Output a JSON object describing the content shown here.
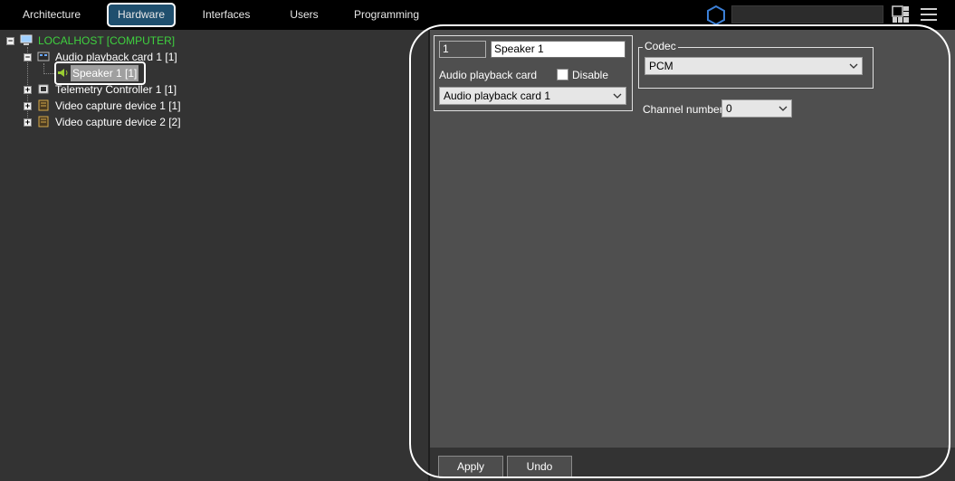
{
  "nav": {
    "tabs": [
      {
        "label": "Architecture"
      },
      {
        "label": "Hardware"
      },
      {
        "label": "Interfaces"
      },
      {
        "label": "Users"
      },
      {
        "label": "Programming"
      }
    ],
    "active_tab": "Hardware",
    "search": {
      "value": "",
      "placeholder": ""
    }
  },
  "tree": {
    "root": "LOCALHOST [COMPUTER]",
    "items": [
      {
        "label": "Audio playback card 1 [1]",
        "icon": "audio-card-icon",
        "expanded": true
      },
      {
        "label": "Speaker 1 [1]",
        "icon": "speaker-icon",
        "selected": true
      },
      {
        "label": "Telemetry Controller 1 [1]",
        "icon": "telemetry-icon",
        "expanded": false
      },
      {
        "label": "Video capture device 1 [1]",
        "icon": "video-card-icon",
        "expanded": false
      },
      {
        "label": "Video capture device 2 [2]",
        "icon": "video-card-icon",
        "expanded": false
      }
    ]
  },
  "settings": {
    "id_value": "1",
    "name_value": "Speaker 1",
    "audio_card_label": "Audio playback card",
    "disable_label": "Disable",
    "disable_checked": false,
    "audio_card_value": "Audio playback card 1",
    "codec_label": "Codec",
    "codec_value": "PCM",
    "channel_label": "Channel number",
    "channel_value": "0"
  },
  "footer": {
    "apply_label": "Apply",
    "undo_label": "Undo"
  },
  "colors": {
    "accent": "#1f4f6e",
    "root_green": "#3fd13f",
    "panel_left": "#333333",
    "panel_right": "#4f4f4f"
  }
}
